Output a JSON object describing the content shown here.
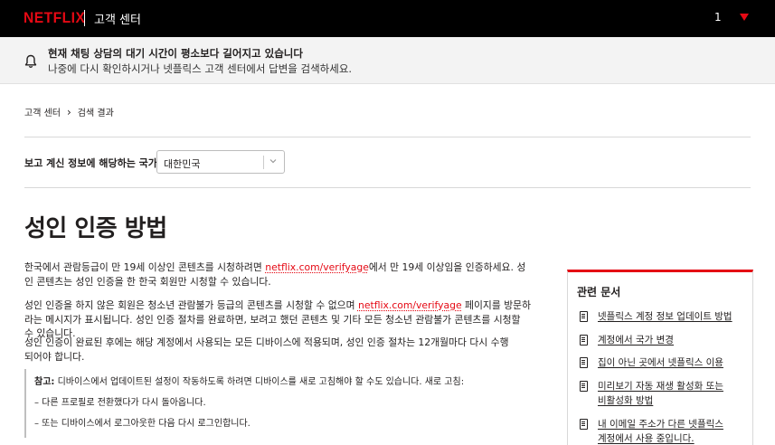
{
  "header": {
    "logo": "NETFLIX",
    "section": "고객 센터",
    "user_indicator": "1",
    "brand_color": "#e50914"
  },
  "alert": {
    "icon": "bell-icon",
    "title": "현재 채팅 상담의 대기 시간이 평소보다 길어지고 있습니다",
    "body": "나중에 다시 확인하시거나 넷플릭스 고객 센터에서 답변을 검색하세요."
  },
  "breadcrumb": {
    "home": "고객 센터",
    "current": "검색 결과"
  },
  "country": {
    "label": "보고 계신 정보에 해당하는 국가:",
    "value": "대한민국"
  },
  "article": {
    "title": "성인 인증 방법",
    "p1_a": "한국에서 관람등급이 만 19세 이상인 콘텐츠를 시청하려면 ",
    "p1_link": "netflix.com/verifyage",
    "p1_b": "에서 만 19세 이상임을 인증하세요. 성인 콘텐츠는 성인 인증을 한 한국 회원만 시청할 수 있습니다.",
    "p2_a": "성인 인증을 하지 않은 회원은 청소년 관람불가 등급의 콘텐츠를 시청할 수 없으며 ",
    "p2_link": "netflix.com/verifyage",
    "p2_b": " 페이지를 방문하라는 메시지가 표시됩니다. 성인 인증 절차를 완료하면, 보려고 했던 콘텐츠 및 기타 모든 청소년 관람불가 콘텐츠를 시청할 수 있습니다.",
    "p3": "성인 인증이 완료된 후에는 해당 계정에서 사용되는 모든 디바이스에 적용되며, 성인 인증 절차는 12개월마다 다시 수행되어야 합니다.",
    "note_label": "참고:",
    "note_text": " 디바이스에서 업데이트된 설정이 작동하도록 하려면 디바이스를 새로 고침해야 할 수도 있습니다. 새로 고침:",
    "note_item1": "– 다른 프로필로 전환했다가 다시 돌아옵니다.",
    "note_item2": "– 또는 디바이스에서 로그아웃한 다음 다시 로그인합니다."
  },
  "related": {
    "title": "관련 문서",
    "items": [
      {
        "label": "넷플릭스 계정 정보 업데이트 방법"
      },
      {
        "label": "계정에서 국가 변경"
      },
      {
        "label": "집이 아닌 곳에서 넷플릭스 이용"
      },
      {
        "label": "미리보기 자동 재생 활성화 또는 비활성화 방법"
      },
      {
        "label": "내 이메일 주소가 다른 넷플릭스 계정에서 사용 중입니다."
      }
    ]
  }
}
